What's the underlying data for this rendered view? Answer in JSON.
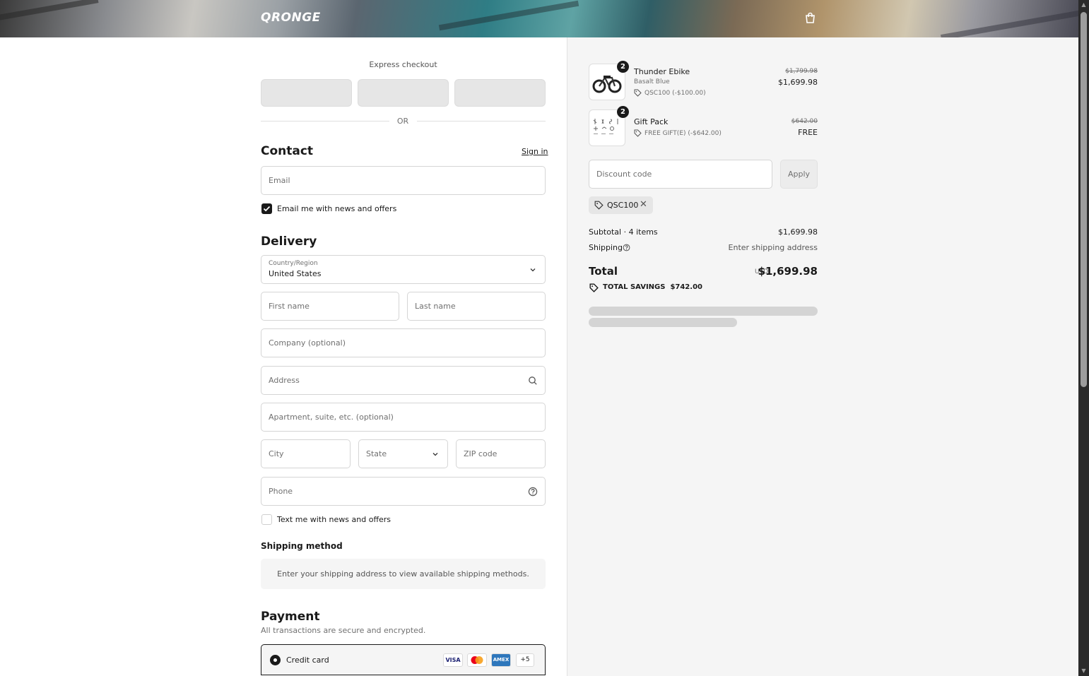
{
  "header": {
    "logo": "QRONGE",
    "cart_icon": "shopping-bag-icon"
  },
  "express": {
    "title": "Express checkout",
    "or": "OR"
  },
  "contact": {
    "heading": "Contact",
    "sign_in": "Sign in",
    "email_placeholder": "Email",
    "newsletter_label": "Email me with news and offers",
    "newsletter_checked": true
  },
  "delivery": {
    "heading": "Delivery",
    "country_label": "Country/Region",
    "country_value": "United States",
    "first_name": "First name",
    "last_name": "Last name",
    "company": "Company (optional)",
    "address": "Address",
    "apartment": "Apartment, suite, etc. (optional)",
    "city": "City",
    "state": "State",
    "zip": "ZIP code",
    "phone": "Phone",
    "sms_label": "Text me with news and offers",
    "sms_checked": false
  },
  "shipping": {
    "heading": "Shipping method",
    "info": "Enter your shipping address to view available shipping methods."
  },
  "payment": {
    "heading": "Payment",
    "subtitle": "All transactions are secure and encrypted.",
    "method": "Credit card",
    "cards": [
      "VISA",
      "mastercard",
      "AMEX"
    ],
    "more": "+5"
  },
  "summary": {
    "items": [
      {
        "qty": "2",
        "name": "Thunder Ebike",
        "variant": "Basalt Blue",
        "discount": "QSC100 (-$100.00)",
        "original": "$1,799.98",
        "price": "$1,699.98"
      },
      {
        "qty": "2",
        "name": "Gift Pack",
        "variant": "",
        "discount": "FREE GIFT(E) (-$642.00)",
        "original": "$642.00",
        "price": "FREE"
      }
    ],
    "discount_placeholder": "Discount code",
    "apply": "Apply",
    "applied_code": "QSC100",
    "subtotal_label": "Subtotal · 4 items",
    "subtotal_value": "$1,699.98",
    "shipping_label": "Shipping",
    "shipping_value": "Enter shipping address",
    "total_label": "Total",
    "currency": "USD",
    "total_value": "$1,699.98",
    "savings_label": "TOTAL SAVINGS",
    "savings_value": "$742.00"
  }
}
